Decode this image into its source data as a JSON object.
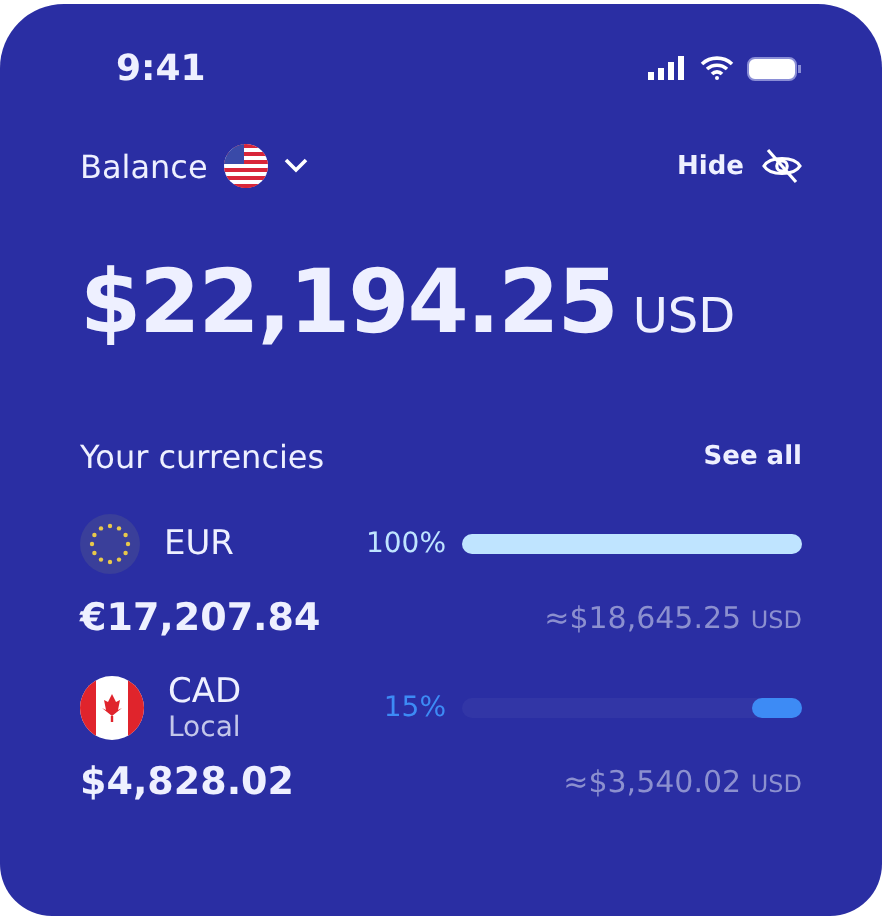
{
  "status_bar": {
    "time": "9:41"
  },
  "balance": {
    "label": "Balance",
    "hide_label": "Hide",
    "amount": "$22,194.25",
    "currency": "USD"
  },
  "currencies": {
    "title": "Your currencies",
    "see_all": "See all",
    "items": [
      {
        "code": "EUR",
        "percent": "100%",
        "level": 1,
        "color": "#bfe4ff",
        "amount": "€17,207.84",
        "converted": "≈$18,645.25",
        "converted_unit": "USD"
      },
      {
        "code": "CAD",
        "subtitle": "Local",
        "percent": "15%",
        "level": 0.15,
        "color": "#3d8bf5",
        "amount": "$4,828.02",
        "converted": "≈$3,540.02",
        "converted_unit": "USD"
      }
    ]
  }
}
